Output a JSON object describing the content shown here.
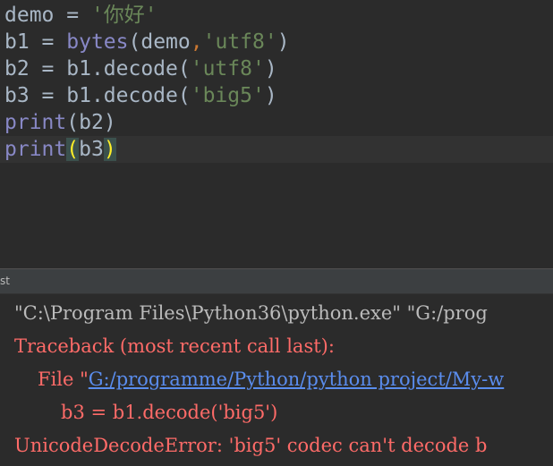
{
  "editor": {
    "lines": [
      {
        "var": "demo",
        "eq": " = ",
        "str": "'你好'"
      },
      {
        "var": "b1",
        "eq": " = ",
        "fn": "bytes",
        "open": "(",
        "arg1": "demo",
        "comma": ",",
        "arg2": "'utf8'",
        "close": ")"
      },
      {
        "var": "b2",
        "eq": " = ",
        "obj": "b1.decode",
        "open": "(",
        "arg": "'utf8'",
        "close": ")"
      },
      {
        "var": "b3",
        "eq": " = ",
        "obj": "b1.decode",
        "open": "(",
        "arg": "'big5'",
        "close": ")"
      },
      {
        "fn": "print",
        "open": "(",
        "arg": "b2",
        "close": ")"
      },
      {
        "fn": "print",
        "open": "(",
        "arg": "b3",
        "close": ")"
      }
    ]
  },
  "run_panel": {
    "title": "st"
  },
  "console": {
    "command_prefix": "\"C:\\Program Files\\Python36\\python.exe\" \"G:/prog",
    "traceback_header": "Traceback (most recent call last):",
    "file_prefix": "File \"",
    "file_link": "G:/programme/Python/python project/My-w",
    "code_line": "b3 = b1.decode('big5')",
    "error_line": "UnicodeDecodeError: 'big5' codec can't decode b"
  },
  "colors": {
    "editor_bg": "#2b2b2b",
    "current_line_bg": "#323232",
    "string": "#6a8759",
    "builtin": "#8888c6",
    "comma": "#cc7832",
    "bracket_match": "#ffef28",
    "error": "#ff6b68",
    "link": "#5a8dee"
  }
}
